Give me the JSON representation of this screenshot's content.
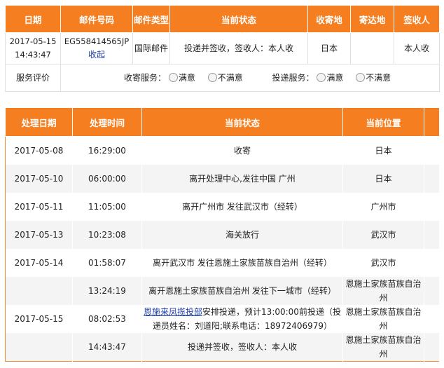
{
  "summary": {
    "headers": [
      "日期",
      "邮件号码",
      "邮件类型",
      "当前状态",
      "收寄地",
      "寄达地",
      "签收人"
    ],
    "row": {
      "date": "2017-05-15 14:43:47",
      "tracking_number": "EG558414565JP",
      "collapse_link": "收起",
      "type": "国际邮件",
      "status": "投递并签收，签收人：本人收",
      "origin": "日本",
      "destination": "",
      "signer": "本人收"
    },
    "rating": {
      "label": "服务评价",
      "pickup_label": "收寄服务：",
      "delivery_label": "投递服务：",
      "options": [
        "满意",
        "不满意"
      ]
    }
  },
  "details": {
    "headers": [
      "处理日期",
      "处理时间",
      "当前状态",
      "当前位置"
    ],
    "rows": [
      {
        "date": "2017-05-08",
        "time": "16:29:00",
        "status": "收寄",
        "location": "日本"
      },
      {
        "date": "2017-05-10",
        "time": "06:00:00",
        "status": "离开处理中心,发往中国 广州",
        "location": "日本"
      },
      {
        "date": "2017-05-11",
        "time": "11:05:00",
        "status": "离开广州市 发往武汉市（经转）",
        "location": "广州市"
      },
      {
        "date": "2017-05-13",
        "time": "10:23:08",
        "status": "海关放行",
        "location": "武汉市"
      },
      {
        "date": "2017-05-14",
        "time": "01:58:07",
        "status": "离开武汉市 发往恩施土家族苗族自治州（经转）",
        "location": "武汉市"
      },
      {
        "date": "",
        "time": "13:24:19",
        "status": "离开恩施土家族苗族自治州 发往下一城市（经转）",
        "location": "恩施土家族苗族自治州"
      },
      {
        "date": "2017-05-15",
        "time": "08:02:53",
        "status_link": "恩施来凤揽投部",
        "status_rest": "安排投递，预计13:00:00前投递（投递员姓名：刘道阳;联系电话：18972406979）",
        "location": "恩施土家族苗族自治州"
      },
      {
        "date": "",
        "time": "14:43:47",
        "status": "投递并签收，签收人：本人收",
        "location": "恩施土家族苗族自治州"
      }
    ]
  }
}
